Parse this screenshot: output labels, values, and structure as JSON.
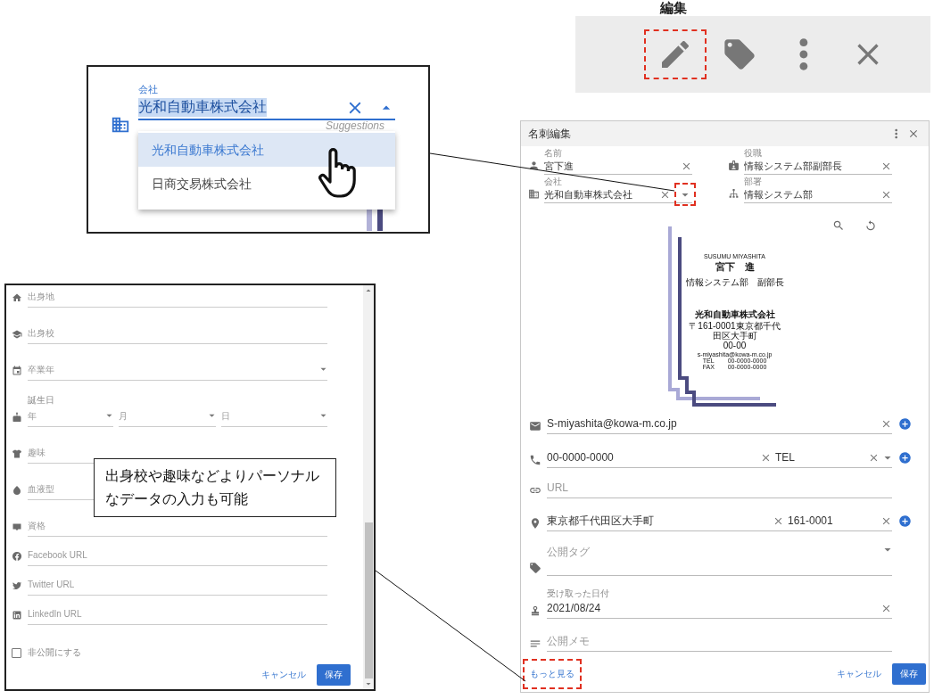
{
  "toolbar": {
    "title": "編集",
    "buttons": [
      {
        "kind": "edit",
        "highlighted": true
      },
      {
        "kind": "tag",
        "highlighted": false
      },
      {
        "kind": "more",
        "highlighted": false
      },
      {
        "kind": "close",
        "highlighted": false
      }
    ]
  },
  "company_zoom": {
    "label": "会社",
    "value": "光和自動車株式会社",
    "hint": "Suggestions",
    "suggestions": [
      {
        "text": "光和自動車株式会社",
        "selected": true
      },
      {
        "text": "日商交易株式会社",
        "selected": false
      }
    ]
  },
  "dialog": {
    "title": "名刺編集",
    "top_fields": [
      {
        "kind": "person",
        "label": "名前",
        "value": "宮下進",
        "dropdown": false,
        "highlighted": false
      },
      {
        "kind": "badge",
        "label": "役職",
        "value": "情報システム部副部長",
        "dropdown": false,
        "highlighted": false
      },
      {
        "kind": "business",
        "label": "会社",
        "value": "光和自動車株式会社",
        "dropdown": true,
        "highlighted": true
      },
      {
        "kind": "org",
        "label": "部署",
        "value": "情報システム部",
        "dropdown": false,
        "highlighted": false
      }
    ],
    "card": {
      "name_roman": "SUSUMU MIYASHITA",
      "name": "宮下　進",
      "title": "情報システム部　副部長",
      "company": "光和自動車株式会社",
      "address_lines": [
        "〒161-0001東京都千代田区大手町",
        "00-00"
      ],
      "email": "s-miyashita@kowa-m.co.jp",
      "phones": [
        {
          "label": "TEL",
          "number": "00-0000-0000"
        },
        {
          "label": "FAX",
          "number": "00-0000-0000"
        }
      ]
    },
    "fields": [
      {
        "kind": "email",
        "value": "S-miyashita@kowa-m.co.jp",
        "dropdown": false,
        "add": true
      },
      {
        "kind": "phone",
        "value": "00-0000-0000",
        "extra": "TEL",
        "dropdown": true,
        "add": true
      },
      {
        "kind": "link",
        "placeholder": "URL",
        "dropdown": false,
        "add": false
      },
      {
        "kind": "place",
        "value": "東京都千代田区大手町",
        "extra": "161-0001",
        "dropdown": false,
        "add": true
      },
      {
        "kind": "tag",
        "placeholder": "公開タグ",
        "dropdown": true,
        "add": false
      },
      {
        "kind": "stamp",
        "label": "受け取った日付",
        "value": "2021/08/24",
        "dropdown": false,
        "add": false
      },
      {
        "kind": "notes",
        "placeholder": "公開メモ",
        "dropdown": false,
        "add": false
      }
    ],
    "more_link": {
      "text": "もっと見る",
      "highlighted": true
    },
    "cancel": "キャンセル",
    "save": "保存"
  },
  "more_panel": {
    "fields": [
      {
        "kind": "home",
        "placeholder": "出身地",
        "dropdown": false
      },
      {
        "kind": "school",
        "placeholder": "出身校",
        "dropdown": false
      },
      {
        "kind": "calendar",
        "placeholder": "卒業年",
        "dropdown": true
      },
      {
        "kind": "cake",
        "label": "誕生日",
        "selects": [
          {
            "placeholder": "年"
          },
          {
            "placeholder": "月"
          },
          {
            "placeholder": "日"
          }
        ]
      },
      {
        "kind": "shirt",
        "placeholder": "趣味",
        "dropdown": false
      },
      {
        "kind": "drop",
        "placeholder": "血液型",
        "dropdown": false
      },
      {
        "kind": "certificate",
        "placeholder": "資格",
        "dropdown": false
      },
      {
        "kind": "facebook",
        "placeholder": "Facebook URL",
        "dropdown": false
      },
      {
        "kind": "twitter",
        "placeholder": "Twitter URL",
        "dropdown": false
      },
      {
        "kind": "linkedin",
        "placeholder": "LinkedIn URL",
        "dropdown": false
      }
    ],
    "private_checkbox": {
      "label": "非公開にする",
      "checked": false
    },
    "cancel": "キャンセル",
    "save": "保存"
  },
  "caption": "出身校や趣味などよりパーソナルなデータの入力も可能"
}
